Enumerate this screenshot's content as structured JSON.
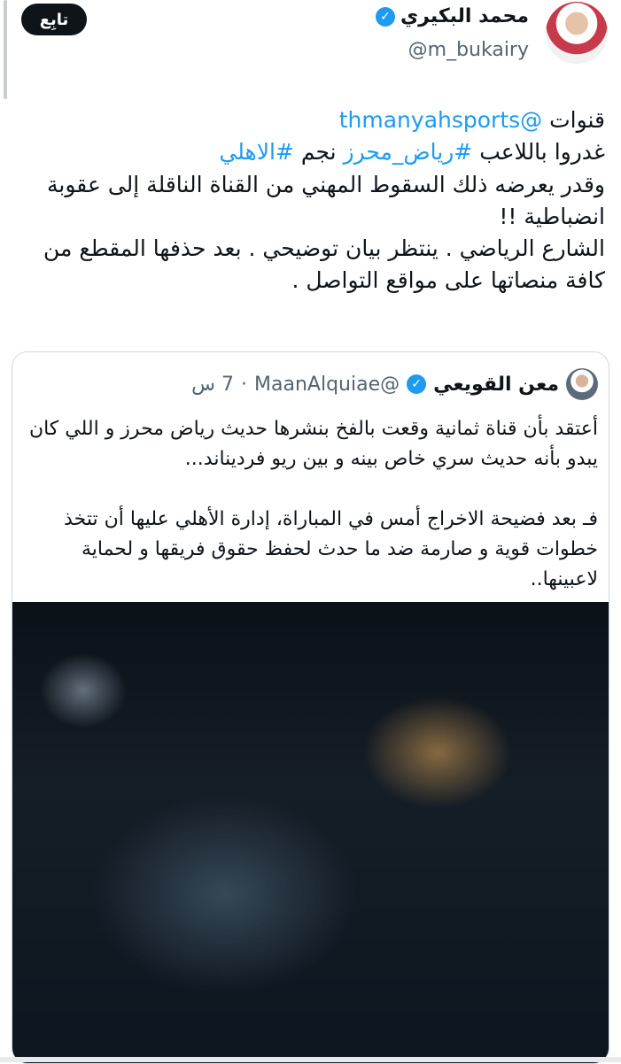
{
  "header": {
    "follow_label": "تابِع",
    "display_name": "محمد البكيري",
    "handle": "@m_bukairy"
  },
  "tweet": {
    "line1_prefix": "قنوات",
    "line1_mention": "@thmanyahsports",
    "line2_text1": "غدروا باللاعب",
    "line2_tag1": "#رياض_محرز",
    "line2_text2": "نجم",
    "line2_tag2": "#الاهلي",
    "line3": "وقدر يعرضه ذلك السقوط المهني من القناة الناقلة إلى عقوبة انضباطية !!",
    "line4": "الشارع الرياضي . ينتظر بيان توضيحي . بعد حذفها المقطع من كافة منصاتها على مواقع التواصل ."
  },
  "quoted": {
    "name": "معن القويعي",
    "handle": "@MaanAlquiae",
    "separator": "·",
    "time": "7 س",
    "para1": "أعتقد بأن قناة ثمانية وقعت بالفخ بنشرها حديث رياض محرز و اللي كان يبدو بأنه حديث سري خاص بينه و بين ريو فرديناند...",
    "para2": "فـ بعد فضيحة الاخراج أمس في المباراة، إدارة الأهلي عليها أن تتخذ خطوات قوية و صارمة ضد ما حدث لحفظ حقوق فريقها و لحماية لاعبينها.."
  },
  "icons": {
    "verified": "verified-badge-icon"
  }
}
